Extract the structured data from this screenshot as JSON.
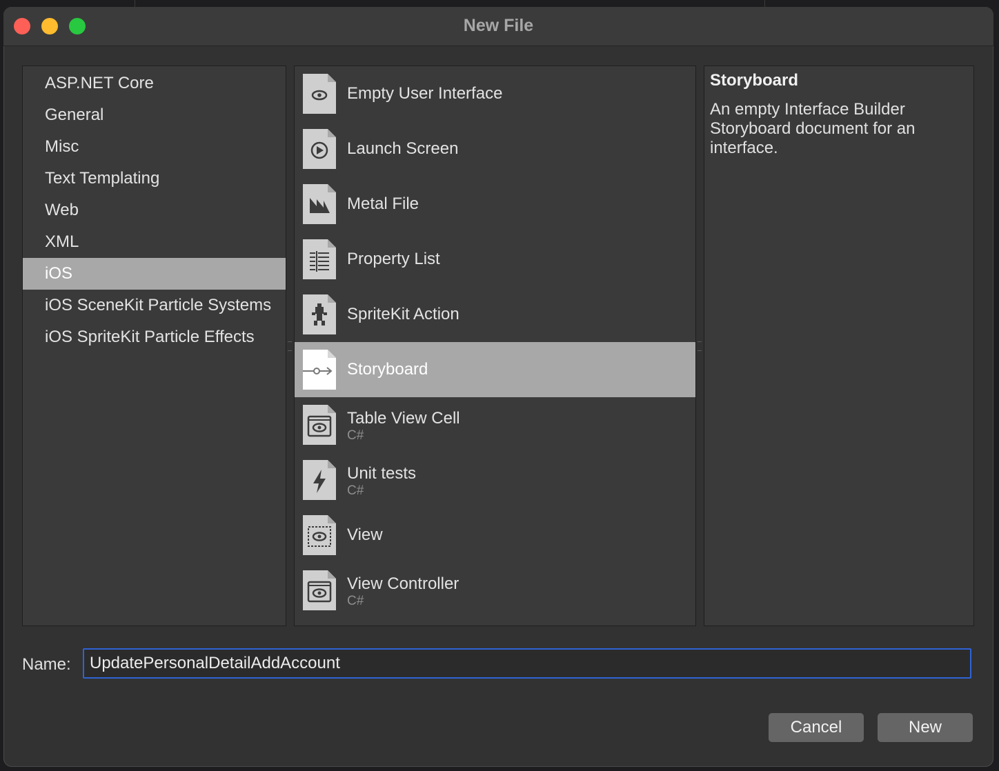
{
  "window": {
    "title": "New File"
  },
  "categories": [
    {
      "label": "ASP.NET Core",
      "selected": false
    },
    {
      "label": "General",
      "selected": false
    },
    {
      "label": "Misc",
      "selected": false
    },
    {
      "label": "Text Templating",
      "selected": false
    },
    {
      "label": "Web",
      "selected": false
    },
    {
      "label": "XML",
      "selected": false
    },
    {
      "label": "iOS",
      "selected": true
    },
    {
      "label": "iOS SceneKit Particle Systems",
      "selected": false
    },
    {
      "label": "iOS SpriteKit Particle Effects",
      "selected": false
    }
  ],
  "templates": [
    {
      "label": "Empty User Interface",
      "sub": "",
      "icon": "eye-icon",
      "selected": false
    },
    {
      "label": "Launch Screen",
      "sub": "",
      "icon": "play-circle-icon",
      "selected": false
    },
    {
      "label": "Metal File",
      "sub": "",
      "icon": "metal-icon",
      "selected": false
    },
    {
      "label": "Property List",
      "sub": "",
      "icon": "list-icon",
      "selected": false
    },
    {
      "label": "SpriteKit Action",
      "sub": "",
      "icon": "sprite-icon",
      "selected": false
    },
    {
      "label": "Storyboard",
      "sub": "",
      "icon": "storyboard-icon",
      "selected": true
    },
    {
      "label": "Table View Cell",
      "sub": "C#",
      "icon": "window-eye-icon",
      "selected": false
    },
    {
      "label": "Unit tests",
      "sub": "C#",
      "icon": "bolt-icon",
      "selected": false
    },
    {
      "label": "View",
      "sub": "",
      "icon": "dashed-eye-icon",
      "selected": false
    },
    {
      "label": "View Controller",
      "sub": "C#",
      "icon": "window-eye-icon",
      "selected": false
    }
  ],
  "description": {
    "title": "Storyboard",
    "body": "An empty Interface Builder Storyboard document for an interface."
  },
  "name_field": {
    "label": "Name:",
    "value": "UpdatePersonalDetailAddAccount"
  },
  "buttons": {
    "cancel": "Cancel",
    "new": "New"
  },
  "colors": {
    "selection": "#a8a8a8",
    "focus_ring": "#2f63d6",
    "close": "#fe5f57",
    "minimize": "#febc2e",
    "maximize": "#28c840"
  }
}
